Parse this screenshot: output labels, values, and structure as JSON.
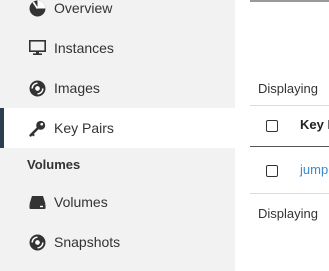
{
  "sidebar": {
    "items": [
      {
        "label": "Overview",
        "icon": "dashboard-icon"
      },
      {
        "label": "Instances",
        "icon": "monitor-icon"
      },
      {
        "label": "Images",
        "icon": "disc-icon"
      },
      {
        "label": "Key Pairs",
        "icon": "key-icon",
        "active": true
      }
    ],
    "volumes_section": {
      "title": "Volumes",
      "items": [
        {
          "label": "Volumes",
          "icon": "hard-drive-icon"
        },
        {
          "label": "Snapshots",
          "icon": "camera-disc-icon"
        }
      ]
    }
  },
  "main": {
    "displaying_top": "Displaying",
    "displaying_bottom": "Displaying",
    "table": {
      "columns": [
        "Key Pair Name"
      ],
      "rows": [
        {
          "name": "jumphost"
        }
      ]
    }
  },
  "colors": {
    "sidebar_bg": "#f2f2f2",
    "active_marker": "#2c3e50",
    "link": "#3b8bd0"
  }
}
